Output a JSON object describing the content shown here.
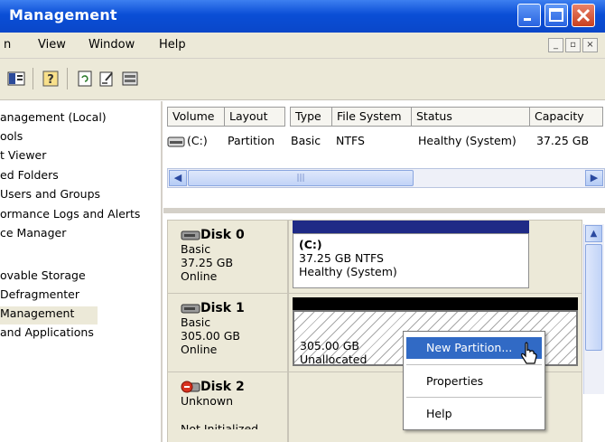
{
  "window": {
    "title": "Management"
  },
  "menu": {
    "items": [
      "n",
      "View",
      "Window",
      "Help"
    ]
  },
  "tree": {
    "items": [
      "anagement (Local)",
      "ools",
      "t Viewer",
      "ed Folders",
      " Users and Groups",
      "ormance Logs and Alerts",
      "ce Manager",
      "",
      "ovable Storage",
      " Defragmenter",
      " Management",
      " and Applications"
    ],
    "selected_index": 10
  },
  "list": {
    "columns": [
      "Volume",
      "Layout",
      "Type",
      "File System",
      "Status",
      "Capacity"
    ],
    "rows": [
      {
        "volume": "(C:)",
        "layout": "Partition",
        "type": "Basic",
        "fs": "NTFS",
        "status": "Healthy (System)",
        "capacity": "37.25 GB"
      }
    ]
  },
  "disks": [
    {
      "name": "Disk 0",
      "type": "Basic",
      "size": "37.25 GB",
      "state": "Online",
      "partition": {
        "label": "(C:)",
        "line2": "37.25 GB NTFS",
        "line3": "Healthy (System)",
        "bar_color": "#1f2a86"
      }
    },
    {
      "name": "Disk 1",
      "type": "Basic",
      "size": "305.00 GB",
      "state": "Online",
      "partition": {
        "label": "305.00 GB",
        "line2": "Unallocated",
        "bar_color": "#000000"
      }
    },
    {
      "name": "Disk 2",
      "type": "Unknown",
      "size": "",
      "state": "Not Initialized"
    }
  ],
  "context_menu": {
    "items": [
      "New Partition...",
      "Properties",
      "Help"
    ],
    "highlighted": "New Partition..."
  },
  "colors": {
    "titlebar": "#0a4ed6",
    "selection": "#316ac5",
    "disk0_bar": "#1f2a86",
    "disk1_bar": "#000000"
  }
}
